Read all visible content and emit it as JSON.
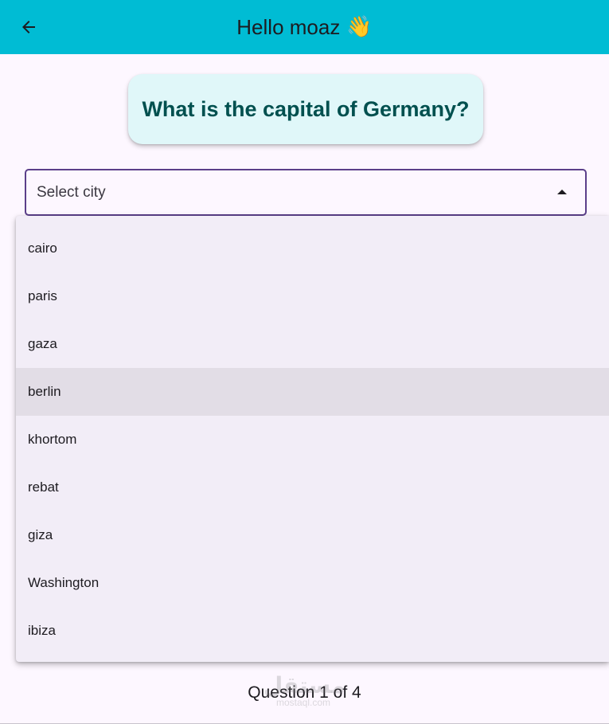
{
  "app_bar": {
    "title": "Hello moaz",
    "title_emoji": "👋",
    "back_icon": "arrow-left-icon",
    "background_color": "#00bcd4"
  },
  "question": {
    "text": "What is the capital of Germany?",
    "card_color": "#e0f7f9",
    "text_color": "#00504f"
  },
  "city_select": {
    "placeholder": "Select city",
    "caret_icon": "caret-up-icon",
    "border_color": "#5b3f8a"
  },
  "dropdown": {
    "highlighted_index": 3,
    "options": [
      "cairo",
      "paris",
      "gaza",
      "berlin",
      "khortom",
      "rebat",
      "giza",
      "Washington",
      "ibiza"
    ]
  },
  "footer": {
    "progress_text": "Question 1 of 4"
  },
  "watermark": {
    "main": "مستقل",
    "sub": "mostaql.com"
  }
}
